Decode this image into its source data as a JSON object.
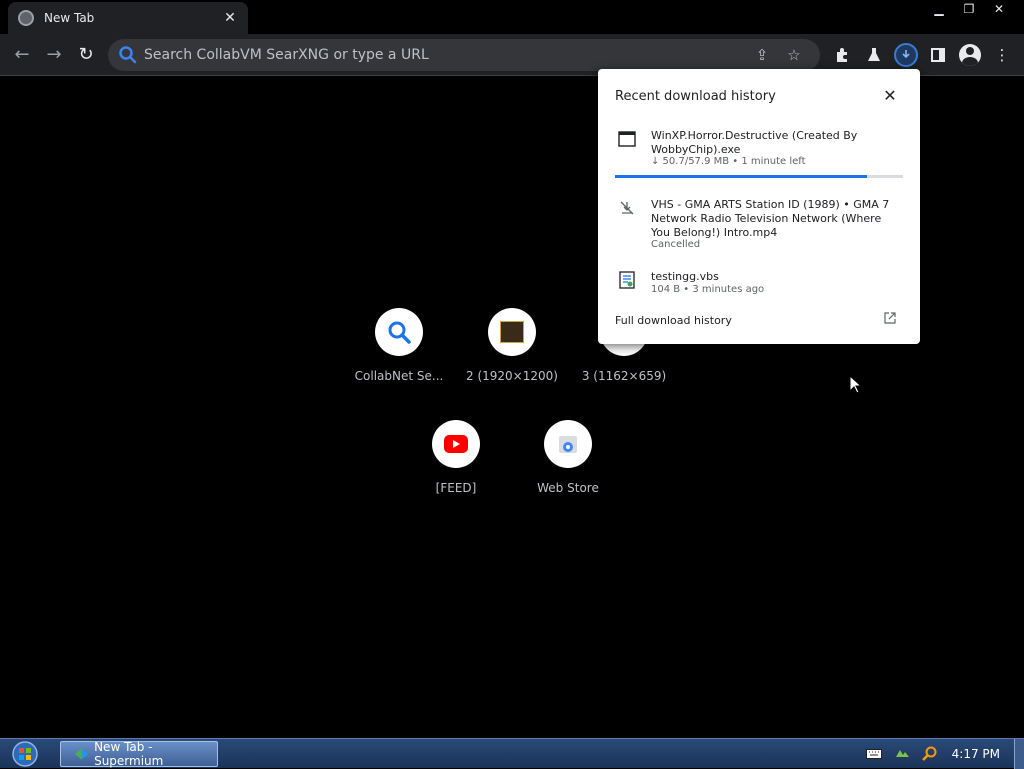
{
  "tab": {
    "title": "New Tab"
  },
  "toolbar": {
    "omnibox_placeholder": "Search CollabVM SearXNG or type a URL"
  },
  "shortcuts": [
    {
      "label": "CollabNet Se...",
      "icon": "search-icon"
    },
    {
      "label": "2 (1920×1200)",
      "icon": "thumbnail-icon"
    },
    {
      "label": "3 (1162×659)",
      "icon": "thumbnail-icon"
    },
    {
      "label": "[FEED]",
      "icon": "youtube-icon"
    },
    {
      "label": "Web Store",
      "icon": "web-store-icon"
    }
  ],
  "downloads": {
    "title": "Recent download history",
    "items": [
      {
        "name": "WinXP.Horror.Destructive  (Created By WobbyChip).exe",
        "status": "↓ 50.7/57.9 MB • 1 minute left",
        "progress": 0.875,
        "icon": "exe-file-icon"
      },
      {
        "name": "VHS - GMA ARTS Station ID (1989) • GMA 7 Network Radio Television Network (Where You Belong!) Intro.mp4",
        "status": "Cancelled",
        "icon": "cancelled-download-icon"
      },
      {
        "name": "testingg.vbs",
        "status": "104 B • 3 minutes ago",
        "icon": "script-file-icon"
      }
    ],
    "full_history_label": "Full download history"
  },
  "taskbar": {
    "app_label": "New Tab - Supermium",
    "clock": "4:17 PM"
  },
  "colors": {
    "accent": "#1a73e8",
    "toolbar_bg": "#202124",
    "page_bg": "#000000",
    "youtube_red": "#ff0000"
  }
}
